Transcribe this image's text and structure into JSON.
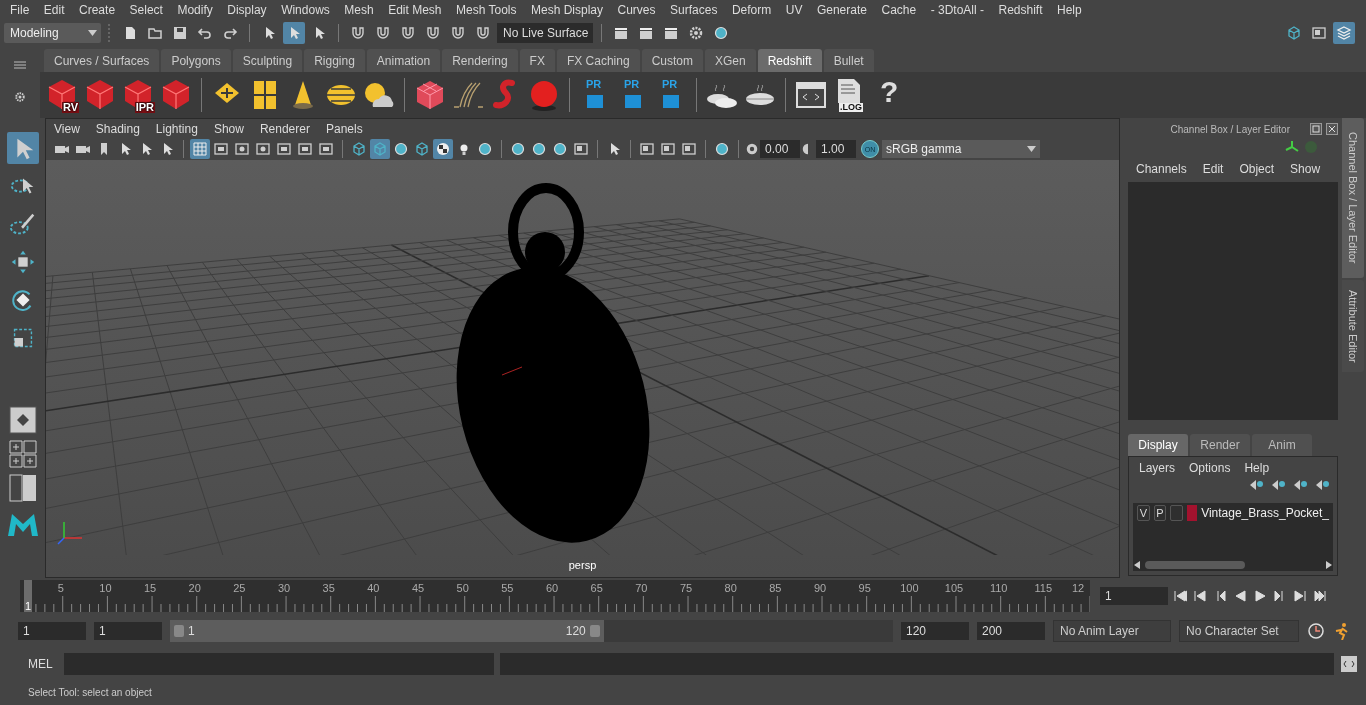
{
  "menu_bar": [
    "File",
    "Edit",
    "Create",
    "Select",
    "Modify",
    "Display",
    "Windows",
    "Mesh",
    "Edit Mesh",
    "Mesh Tools",
    "Mesh Display",
    "Curves",
    "Surfaces",
    "Deform",
    "UV",
    "Generate",
    "Cache",
    "- 3DtoAll -",
    "Redshift",
    "Help"
  ],
  "status_line": {
    "mode": "Modeling",
    "live_surface": "No Live Surface",
    "tools": [
      {
        "kind": "doc",
        "selected": false
      },
      {
        "kind": "folder",
        "selected": false
      },
      {
        "kind": "disk",
        "selected": false
      },
      {
        "kind": "undo",
        "selected": false
      },
      {
        "kind": "redo",
        "selected": false
      },
      {
        "kind": "separator"
      },
      {
        "kind": "pick",
        "selected": false
      },
      {
        "kind": "pick",
        "selected": true
      },
      {
        "kind": "pick",
        "selected": false
      },
      {
        "kind": "separator"
      },
      {
        "kind": "magnet",
        "selected": false
      },
      {
        "kind": "magnet",
        "selected": false
      },
      {
        "kind": "magnet",
        "selected": false
      },
      {
        "kind": "magnet",
        "selected": false
      },
      {
        "kind": "magnet",
        "selected": false
      },
      {
        "kind": "magnet",
        "selected": false
      }
    ],
    "render_tools": [
      {
        "kind": "clapper",
        "selected": false
      },
      {
        "kind": "clapper",
        "selected": false
      },
      {
        "kind": "clapper",
        "selected": false
      },
      {
        "kind": "gear",
        "selected": false
      },
      {
        "kind": "ball",
        "selected": false
      }
    ],
    "panel_tools": [
      {
        "kind": "cube",
        "selected": false
      },
      {
        "kind": "panel",
        "selected": false
      },
      {
        "kind": "layers",
        "selected": true
      }
    ]
  },
  "shelf": {
    "tabs": [
      {
        "label": "Curves / Surfaces",
        "selected": false
      },
      {
        "label": "Polygons",
        "selected": false
      },
      {
        "label": "Sculpting",
        "selected": false
      },
      {
        "label": "Rigging",
        "selected": false
      },
      {
        "label": "Animation",
        "selected": false
      },
      {
        "label": "Rendering",
        "selected": false
      },
      {
        "label": "FX",
        "selected": false
      },
      {
        "label": "FX Caching",
        "selected": false
      },
      {
        "label": "Custom",
        "selected": false
      },
      {
        "label": "XGen",
        "selected": false
      },
      {
        "label": "Redshift",
        "selected": true
      },
      {
        "label": "Bullet",
        "selected": false
      }
    ],
    "items": [
      {
        "kind": "rs-cube",
        "label": "RV"
      },
      {
        "kind": "rs-cube"
      },
      {
        "kind": "rs-cube",
        "label": "IPR"
      },
      {
        "kind": "rs-cube"
      },
      {
        "kind": "separator"
      },
      {
        "kind": "diamond"
      },
      {
        "kind": "tiles"
      },
      {
        "kind": "cone"
      },
      {
        "kind": "dome"
      },
      {
        "kind": "sun-cloud"
      },
      {
        "kind": "separator"
      },
      {
        "kind": "cube-grid"
      },
      {
        "kind": "strands"
      },
      {
        "kind": "worm"
      },
      {
        "kind": "sphere"
      },
      {
        "kind": "separator"
      },
      {
        "kind": "pr",
        "label": "PR"
      },
      {
        "kind": "pr",
        "label": "PR"
      },
      {
        "kind": "pr",
        "label": "PR"
      },
      {
        "kind": "separator"
      },
      {
        "kind": "pies"
      },
      {
        "kind": "pie"
      },
      {
        "kind": "separator"
      },
      {
        "kind": "code"
      },
      {
        "kind": "log",
        "label": ".LOG"
      },
      {
        "kind": "help",
        "label": "?"
      }
    ]
  },
  "toolbox": [
    {
      "kind": "select",
      "selected": true
    },
    {
      "kind": "lasso",
      "selected": false
    },
    {
      "kind": "paint",
      "selected": false
    },
    {
      "kind": "move",
      "selected": false
    },
    {
      "kind": "rotate",
      "selected": false
    },
    {
      "kind": "scale",
      "selected": false
    }
  ],
  "viewport": {
    "menu": [
      "View",
      "Shading",
      "Lighting",
      "Show",
      "Renderer",
      "Panels"
    ],
    "toolbar": [
      {
        "kind": "camera",
        "selected": false
      },
      {
        "kind": "camera",
        "selected": false
      },
      {
        "kind": "bookmark",
        "selected": false
      },
      {
        "kind": "pick",
        "selected": false
      },
      {
        "kind": "pick",
        "selected": false
      },
      {
        "kind": "pick",
        "selected": false
      },
      {
        "kind": "separator"
      },
      {
        "kind": "grid",
        "selected": true
      },
      {
        "kind": "film",
        "selected": false
      },
      {
        "kind": "dot",
        "selected": false
      },
      {
        "kind": "dot",
        "selected": false
      },
      {
        "kind": "film",
        "selected": false
      },
      {
        "kind": "film",
        "selected": false
      },
      {
        "kind": "film",
        "selected": false
      },
      {
        "kind": "separator"
      },
      {
        "kind": "cube",
        "selected": false
      },
      {
        "kind": "cube",
        "selected": true
      },
      {
        "kind": "ball",
        "selected": false
      },
      {
        "kind": "cube",
        "selected": false
      },
      {
        "kind": "checker",
        "selected": true
      },
      {
        "kind": "light",
        "selected": false
      },
      {
        "kind": "ball",
        "selected": false
      },
      {
        "kind": "separator"
      },
      {
        "kind": "ball",
        "selected": false
      },
      {
        "kind": "ball",
        "selected": false
      },
      {
        "kind": "ball",
        "selected": false
      },
      {
        "kind": "panel",
        "selected": false
      },
      {
        "kind": "separator"
      },
      {
        "kind": "pick",
        "selected": false
      },
      {
        "kind": "separator"
      },
      {
        "kind": "panel",
        "selected": false
      },
      {
        "kind": "panel",
        "selected": false
      },
      {
        "kind": "panel",
        "selected": false
      },
      {
        "kind": "separator"
      },
      {
        "kind": "ball",
        "selected": false
      }
    ],
    "exposure": "0.00",
    "gamma": "1.00",
    "view_transform_on": "ON",
    "color_space": "sRGB gamma",
    "camera": "persp"
  },
  "channel_box": {
    "title": "Channel Box / Layer Editor",
    "menu": [
      "Channels",
      "Edit",
      "Object",
      "Show"
    ]
  },
  "layer_editor": {
    "tabs": [
      {
        "label": "Display",
        "selected": true
      },
      {
        "label": "Render",
        "selected": false
      },
      {
        "label": "Anim",
        "selected": false
      }
    ],
    "menu": [
      "Layers",
      "Options",
      "Help"
    ],
    "layers": [
      {
        "visible": "V",
        "playback": "P",
        "color": "#a3122e",
        "name": "Vintage_Brass_Pocket_"
      }
    ]
  },
  "side_tabs": [
    {
      "label": "Channel Box / Layer Editor",
      "selected": true
    },
    {
      "label": "Attribute Editor",
      "selected": false
    }
  ],
  "timeline": {
    "marker": "1",
    "level": 0,
    "ticks": [
      "5",
      "10",
      "15",
      "20",
      "25",
      "30",
      "35",
      "40",
      "45",
      "50",
      "55",
      "60",
      "65",
      "70",
      "75",
      "80",
      "85",
      "90",
      "95",
      "100",
      "105",
      "110",
      "115",
      "12"
    ],
    "current_frame": "1"
  },
  "range": {
    "level": 0.6,
    "start": "1",
    "playback_start": "1",
    "slider_start": "1",
    "slider_end": "120",
    "playback_end": "120",
    "end": "200",
    "anim_layer": "No Anim Layer",
    "character_set": "No Character Set"
  },
  "command_line": {
    "label": "MEL"
  },
  "help_line": "Select Tool: select an object"
}
